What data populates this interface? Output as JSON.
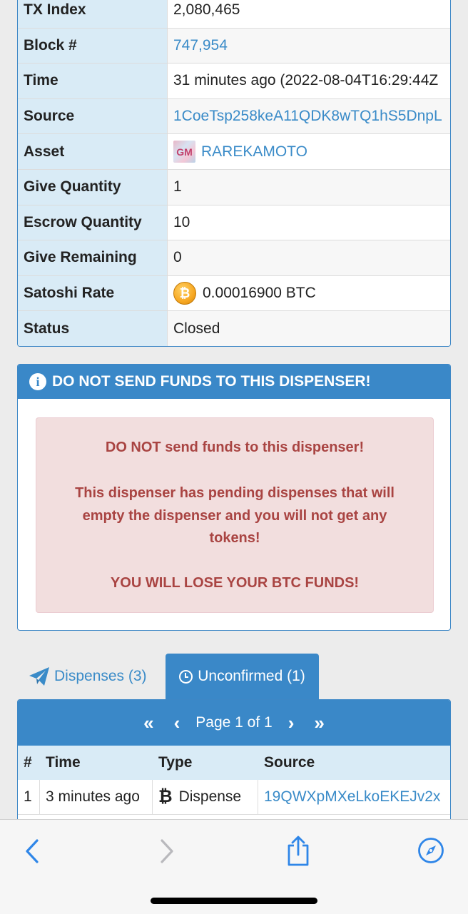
{
  "details": {
    "rows": [
      {
        "label": "TX Index",
        "value": "2,080,465"
      },
      {
        "label": "Block #",
        "value": "747,954"
      },
      {
        "label": "Time",
        "value": "31 minutes ago (2022-08-04T16:29:44Z"
      },
      {
        "label": "Source",
        "value": "1CoeTsp258keA11QDK8wTQ1hS5DnpL"
      },
      {
        "label": "Asset",
        "value": "RAREKAMOTO"
      },
      {
        "label": "Give Quantity",
        "value": "1"
      },
      {
        "label": "Escrow Quantity",
        "value": "10"
      },
      {
        "label": "Give Remaining",
        "value": "0"
      },
      {
        "label": "Satoshi Rate",
        "value": "0.00016900 BTC"
      },
      {
        "label": "Status",
        "value": "Closed"
      }
    ],
    "asset_thumb_text": "GM"
  },
  "warning": {
    "title": "DO NOT SEND FUNDS TO THIS DISPENSER!",
    "line1": "DO NOT send funds to this dispenser!",
    "line2": "This dispenser has pending dispenses that will empty the dispenser and you will not get any tokens!",
    "line3": "YOU WILL LOSE YOUR BTC FUNDS!"
  },
  "tabs": {
    "dispenses": "Dispenses (3)",
    "unconfirmed": "Unconfirmed (1)"
  },
  "pager": {
    "first": "«",
    "prev": "‹",
    "label": "Page 1 of 1",
    "next": "›",
    "last": "»"
  },
  "table": {
    "headers": [
      "#",
      "Time",
      "Type",
      "Source"
    ],
    "rows": [
      {
        "num": "1",
        "time": "3 minutes ago",
        "type": "Dispense",
        "source": "19QWXpMXeLkoEKEJv2x"
      }
    ]
  },
  "colors": {
    "accent": "#3a88c8",
    "label_bg": "#d9ebf6",
    "alert_bg": "#f2dede",
    "alert_text": "#a94442",
    "link": "#3a8bc8"
  },
  "icons": {
    "back": "chevron-left-icon",
    "forward": "chevron-right-icon",
    "share": "share-icon",
    "compass": "compass-icon"
  }
}
